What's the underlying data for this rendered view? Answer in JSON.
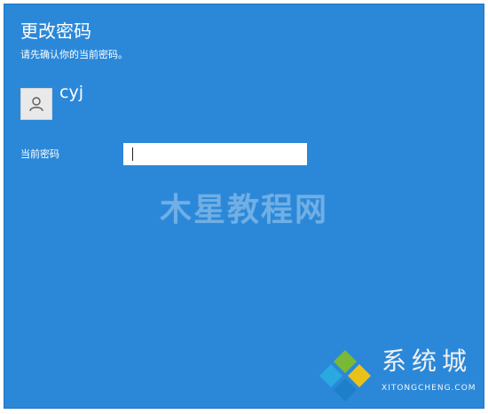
{
  "dialog": {
    "title": "更改密码",
    "subtitle": "请先确认你的当前密码。"
  },
  "user": {
    "avatar_icon": "user-icon",
    "name": "cyj"
  },
  "password_field": {
    "label": "当前密码",
    "value": "",
    "placeholder": ""
  },
  "watermark": {
    "text": "木星教程网"
  },
  "brand": {
    "name": "系统城",
    "domain": "XITONGCHENG.COM",
    "logo_colors": [
      "#7ab935",
      "#2aa9e0",
      "#e8c21b",
      "#1e7fc9"
    ]
  },
  "colors": {
    "panel_background": "#2b88d9"
  }
}
